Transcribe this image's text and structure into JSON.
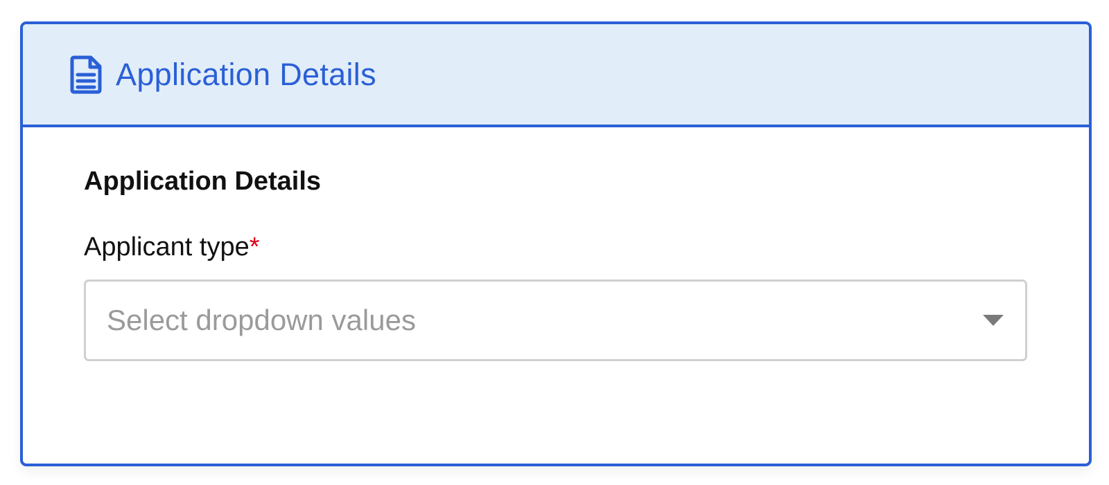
{
  "card": {
    "header_title": "Application Details",
    "header_icon": "document-icon"
  },
  "form": {
    "section_title": "Application Details",
    "applicant_type": {
      "label": "Applicant type",
      "required_marker": "*",
      "placeholder": "Select dropdown values",
      "value": ""
    }
  },
  "colors": {
    "accent": "#2a5fd6",
    "header_bg": "#e1edf9",
    "required": "#e0001b",
    "placeholder": "#9a9a9a"
  }
}
